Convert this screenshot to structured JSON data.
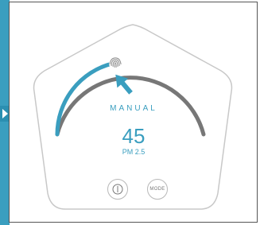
{
  "display": {
    "mode": "MANUAL",
    "value": "45",
    "unit": "PM 2.5"
  },
  "controls": {
    "mode_button_label": "MODE",
    "power_icon": "power-icon"
  },
  "gauge": {
    "level": 0.42
  },
  "colors": {
    "accent": "#3a9ebf",
    "track": "#777777",
    "outline": "#c8c8c8"
  }
}
